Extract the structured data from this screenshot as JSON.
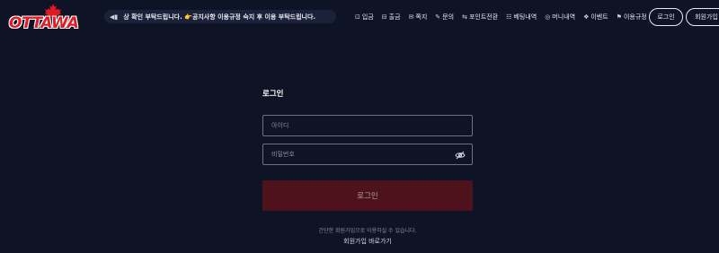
{
  "header": {
    "logo_text": "OTTAWA",
    "marquee_icon": "speaker-icon",
    "marquee_text": "상 확인 부탁드립니다. 👉공지사항 이용규정 숙지 후 이용 부탁드립니다.",
    "nav": [
      {
        "icon": "deposit-icon",
        "glyph": "⊡",
        "label": "입금"
      },
      {
        "icon": "withdraw-icon",
        "glyph": "⊟",
        "label": "출금"
      },
      {
        "icon": "message-icon",
        "glyph": "✉",
        "label": "쪽지"
      },
      {
        "icon": "inquiry-icon",
        "glyph": "✎",
        "label": "문의"
      },
      {
        "icon": "convert-icon",
        "glyph": "⇆",
        "label": "포인트전환"
      },
      {
        "icon": "betting-icon",
        "glyph": "☷",
        "label": "베팅내역"
      },
      {
        "icon": "money-icon",
        "glyph": "◎",
        "label": "머니내역"
      },
      {
        "icon": "gift-icon",
        "glyph": "❖",
        "label": "이벤트"
      },
      {
        "icon": "rules-icon",
        "glyph": "⚑",
        "label": "이용규정"
      }
    ],
    "login_label": "로그인",
    "join_label": "회원가입"
  },
  "form": {
    "title": "로그인",
    "id_placeholder": "아이디",
    "pw_placeholder": "비밀번호",
    "submit_label": "로그인",
    "hint": "간단한 회원가입으로 이용하실 수 있습니다.",
    "join_link": "회원가입 바로가기"
  },
  "colors": {
    "background": "#0f1326",
    "accent_red": "#e01b24",
    "submit_bg": "#4d121b"
  }
}
